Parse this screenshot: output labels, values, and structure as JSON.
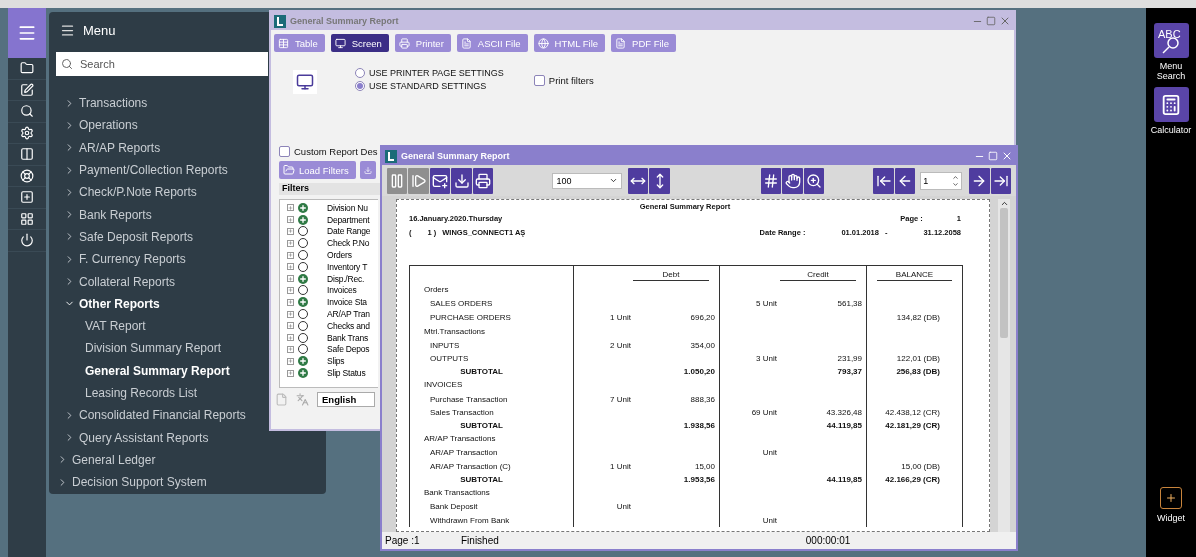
{
  "menu": {
    "title": "Menu",
    "search": {
      "placeholder": "Search"
    },
    "items": [
      {
        "label": "Transactions",
        "expanded": false
      },
      {
        "label": "Operations",
        "expanded": false
      },
      {
        "label": "AR/AP Reports",
        "expanded": false
      },
      {
        "label": "Payment/Collection Reports",
        "expanded": false
      },
      {
        "label": "Check/P.Note Reports",
        "expanded": false
      },
      {
        "label": "Bank Reports",
        "expanded": false
      },
      {
        "label": "Safe Deposit Reports",
        "expanded": false
      },
      {
        "label": "F. Currency Reports",
        "expanded": false
      },
      {
        "label": "Collateral Reports",
        "expanded": false
      },
      {
        "label": "Other Reports",
        "expanded": true,
        "children": [
          {
            "label": "VAT Report",
            "selected": false
          },
          {
            "label": "Division Summary Report",
            "selected": false
          },
          {
            "label": "General Summary Report",
            "selected": true
          },
          {
            "label": "Leasing Records List",
            "selected": false
          }
        ]
      },
      {
        "label": "Consolidated Financial Reports",
        "expanded": false
      },
      {
        "label": "Query Assistant Reports",
        "expanded": false
      }
    ],
    "root_items": [
      {
        "label": "General Ledger",
        "expanded": false
      },
      {
        "label": "Decision Support System",
        "expanded": false
      }
    ]
  },
  "settings_window": {
    "title": "General Summary Report",
    "tabs": [
      {
        "label": "Table",
        "selected": false
      },
      {
        "label": "Screen",
        "selected": true
      },
      {
        "label": "Printer",
        "selected": false
      },
      {
        "label": "ASCII File",
        "selected": false
      },
      {
        "label": "HTML File",
        "selected": false
      },
      {
        "label": "PDF File",
        "selected": false
      }
    ],
    "radios": [
      {
        "label": "USE PRINTER PAGE SETTINGS",
        "selected": false
      },
      {
        "label": "USE STANDARD SETTINGS",
        "selected": true
      }
    ],
    "print_filters": {
      "label": "Print filters",
      "checked": false
    },
    "custom_design": {
      "label": "Custom Report Des",
      "checked": false
    },
    "load_filters": "Load Filters",
    "filters_title": "Filters",
    "filters": [
      {
        "label": "Division Nu",
        "included": true,
        "expanded": false
      },
      {
        "label": "Department",
        "included": true,
        "expanded": false
      },
      {
        "label": "Date Range",
        "included": false,
        "expanded": false
      },
      {
        "label": "Check P.No",
        "included": false,
        "expanded": false
      },
      {
        "label": "Orders",
        "included": false,
        "expanded": false
      },
      {
        "label": "Inventory T",
        "included": false,
        "expanded": false
      },
      {
        "label": "Disp./Rec.",
        "included": true,
        "expanded": false
      },
      {
        "label": "Invoices",
        "included": false,
        "expanded": false
      },
      {
        "label": "Invoice Sta",
        "included": true,
        "expanded": false
      },
      {
        "label": "AR/AP Tran",
        "included": false,
        "expanded": false
      },
      {
        "label": "Checks and",
        "included": false,
        "expanded": false
      },
      {
        "label": "Bank Trans",
        "included": false,
        "expanded": false
      },
      {
        "label": "Safe Depos",
        "included": false,
        "expanded": false
      },
      {
        "label": "Slips",
        "included": true,
        "expanded": false
      },
      {
        "label": "Slip Status",
        "included": true,
        "expanded": false
      }
    ],
    "language": "English"
  },
  "preview_window": {
    "title": "General Summary Report",
    "toolbar": [
      {
        "kind": "pause",
        "disabled": true
      },
      {
        "kind": "step",
        "disabled": true
      },
      {
        "kind": "mail",
        "disabled": false
      },
      {
        "kind": "download",
        "disabled": false
      },
      {
        "kind": "print",
        "disabled": false
      },
      {
        "kind": "zoom_select",
        "value": "100"
      },
      {
        "kind": "fit_width",
        "disabled": false
      },
      {
        "kind": "fit_height",
        "disabled": false
      },
      {
        "kind": "grid",
        "disabled": false
      },
      {
        "kind": "hand",
        "disabled": false
      },
      {
        "kind": "zoom",
        "disabled": false
      },
      {
        "kind": "first",
        "disabled": false
      },
      {
        "kind": "prev",
        "disabled": false
      },
      {
        "kind": "page_input",
        "value": "1"
      },
      {
        "kind": "next",
        "disabled": false
      },
      {
        "kind": "last",
        "disabled": false
      }
    ],
    "report": {
      "title": "General Summary Report",
      "date": "16.January.2020.Thursday",
      "page_label": "Page :",
      "page": "1",
      "company_open": "(",
      "company_no": "1 )",
      "company": "WINGS_CONNECT1 AŞ",
      "range_label": "Date Range :",
      "range_from": "01.01.2018",
      "range_sep": "-",
      "range_to": "31.12.2058",
      "columns": [
        "Debt",
        "Credit",
        "BALANCE"
      ],
      "rows": [
        {
          "kind": "group",
          "label": "Orders"
        },
        {
          "kind": "row",
          "label": "SALES ORDERS",
          "debt_qty": "",
          "debt": "",
          "credit_qty": "5 Unit",
          "credit": "561,38",
          "balance": ""
        },
        {
          "kind": "row",
          "label": "PURCHASE ORDERS",
          "debt_qty": "1 Unit",
          "debt": "696,20",
          "credit_qty": "",
          "credit": "",
          "balance": "134,82 (DB)"
        },
        {
          "kind": "group",
          "label": "Mtrl.Transactions"
        },
        {
          "kind": "row",
          "label": "INPUTS",
          "debt_qty": "2 Unit",
          "debt": "354,00",
          "credit_qty": "",
          "credit": "",
          "balance": ""
        },
        {
          "kind": "row",
          "label": "OUTPUTS",
          "debt_qty": "",
          "debt": "",
          "credit_qty": "3 Unit",
          "credit": "231,99",
          "balance": "122,01 (DB)"
        },
        {
          "kind": "subtotal",
          "label": "SUBTOTAL",
          "debt_qty": "",
          "debt": "1.050,20",
          "credit_qty": "",
          "credit": "793,37",
          "balance": "256,83 (DB)"
        },
        {
          "kind": "group",
          "label": "INVOICES"
        },
        {
          "kind": "row",
          "label": "Purchase Transaction",
          "debt_qty": "7 Unit",
          "debt": "888,36",
          "credit_qty": "",
          "credit": "",
          "balance": ""
        },
        {
          "kind": "row",
          "label": "Sales Transaction",
          "debt_qty": "",
          "debt": "",
          "credit_qty": "69 Unit",
          "credit": "43.326,48",
          "balance": "42.438,12 (CR)"
        },
        {
          "kind": "subtotal",
          "label": "SUBTOTAL",
          "debt_qty": "",
          "debt": "1.938,56",
          "credit_qty": "",
          "credit": "44.119,85",
          "balance": "42.181,29 (CR)"
        },
        {
          "kind": "group",
          "label": "AR/AP Transactions"
        },
        {
          "kind": "row",
          "label": "AR/AP Transaction",
          "debt_qty": "",
          "debt": "",
          "credit_qty": "Unit",
          "credit": "",
          "balance": ""
        },
        {
          "kind": "row",
          "label": "AR/AP Transaction (C)",
          "debt_qty": "1 Unit",
          "debt": "15,00",
          "credit_qty": "",
          "credit": "",
          "balance": "15,00 (DB)"
        },
        {
          "kind": "subtotal",
          "label": "SUBTOTAL",
          "debt_qty": "",
          "debt": "1.953,56",
          "credit_qty": "",
          "credit": "44.119,85",
          "balance": "42.166,29 (CR)"
        },
        {
          "kind": "group",
          "label": "Bank Transactions"
        },
        {
          "kind": "row",
          "label": "Bank Deposit",
          "debt_qty": "Unit",
          "debt": "",
          "credit_qty": "",
          "credit": "",
          "balance": ""
        },
        {
          "kind": "row",
          "label": "Withdrawn From Bank",
          "debt_qty": "",
          "debt": "",
          "credit_qty": "Unit",
          "credit": "",
          "balance": ""
        }
      ]
    },
    "status": {
      "page": "Page :1",
      "state": "Finished",
      "time": "000:00:01"
    }
  },
  "shortcuts": [
    {
      "kind": "search",
      "label": "Menu Search",
      "icon_text": "ABC"
    },
    {
      "kind": "calculator",
      "label": "Calculator"
    }
  ],
  "widget": {
    "label": "Widget"
  }
}
